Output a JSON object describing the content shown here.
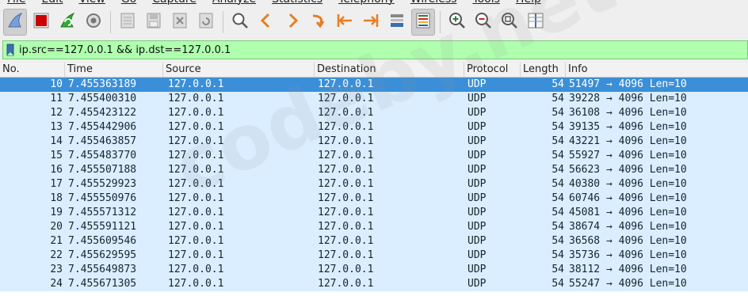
{
  "menu": [
    "File",
    "Edit",
    "View",
    "Go",
    "Capture",
    "Analyze",
    "Statistics",
    "Telephony",
    "Wireless",
    "Tools",
    "Help"
  ],
  "toolbar": [
    {
      "icon": "shark-fin-icon",
      "active": true
    },
    {
      "icon": "stop-icon",
      "active": false
    },
    {
      "icon": "restart-capture-icon",
      "active": false
    },
    {
      "icon": "capture-options-icon",
      "active": false
    },
    {
      "sep": true
    },
    {
      "icon": "open-file-icon",
      "active": false
    },
    {
      "icon": "save-file-icon",
      "active": false
    },
    {
      "icon": "close-file-icon",
      "active": false
    },
    {
      "icon": "reload-icon",
      "active": false
    },
    {
      "sep": true
    },
    {
      "icon": "find-packet-icon",
      "active": false
    },
    {
      "icon": "go-back-icon",
      "active": false
    },
    {
      "icon": "go-forward-icon",
      "active": false
    },
    {
      "icon": "go-to-packet-icon",
      "active": false
    },
    {
      "icon": "first-packet-icon",
      "active": false
    },
    {
      "icon": "last-packet-icon",
      "active": false
    },
    {
      "icon": "auto-scroll-icon",
      "active": false
    },
    {
      "icon": "colorize-icon",
      "active": true
    },
    {
      "sep": true
    },
    {
      "icon": "zoom-in-icon",
      "active": false
    },
    {
      "icon": "zoom-out-icon",
      "active": false
    },
    {
      "icon": "normal-size-icon",
      "active": false
    },
    {
      "icon": "resize-columns-icon",
      "active": false
    }
  ],
  "filter": {
    "value": "ip.src==127.0.0.1 && ip.dst==127.0.0.1"
  },
  "colors": {
    "filter_ok": "#afffaf",
    "selected_row": "#3a8fd8",
    "udp_row": "#daeeff"
  },
  "columns": {
    "no": "No.",
    "time": "Time",
    "source": "Source",
    "destination": "Destination",
    "protocol": "Protocol",
    "length": "Length",
    "info": "Info"
  },
  "packets": [
    {
      "no": "10",
      "time": "7.455363189",
      "src": "127.0.0.1",
      "dst": "127.0.0.1",
      "proto": "UDP",
      "len": "54",
      "info": "51497 → 4096 Len=10",
      "selected": true
    },
    {
      "no": "11",
      "time": "7.455400310",
      "src": "127.0.0.1",
      "dst": "127.0.0.1",
      "proto": "UDP",
      "len": "54",
      "info": "39228 → 4096 Len=10"
    },
    {
      "no": "12",
      "time": "7.455423122",
      "src": "127.0.0.1",
      "dst": "127.0.0.1",
      "proto": "UDP",
      "len": "54",
      "info": "36108 → 4096 Len=10"
    },
    {
      "no": "13",
      "time": "7.455442906",
      "src": "127.0.0.1",
      "dst": "127.0.0.1",
      "proto": "UDP",
      "len": "54",
      "info": "39135 → 4096 Len=10"
    },
    {
      "no": "14",
      "time": "7.455463857",
      "src": "127.0.0.1",
      "dst": "127.0.0.1",
      "proto": "UDP",
      "len": "54",
      "info": "43221 → 4096 Len=10"
    },
    {
      "no": "15",
      "time": "7.455483770",
      "src": "127.0.0.1",
      "dst": "127.0.0.1",
      "proto": "UDP",
      "len": "54",
      "info": "55927 → 4096 Len=10"
    },
    {
      "no": "16",
      "time": "7.455507188",
      "src": "127.0.0.1",
      "dst": "127.0.0.1",
      "proto": "UDP",
      "len": "54",
      "info": "56623 → 4096 Len=10"
    },
    {
      "no": "17",
      "time": "7.455529923",
      "src": "127.0.0.1",
      "dst": "127.0.0.1",
      "proto": "UDP",
      "len": "54",
      "info": "40380 → 4096 Len=10"
    },
    {
      "no": "18",
      "time": "7.455550976",
      "src": "127.0.0.1",
      "dst": "127.0.0.1",
      "proto": "UDP",
      "len": "54",
      "info": "60746 → 4096 Len=10"
    },
    {
      "no": "19",
      "time": "7.455571312",
      "src": "127.0.0.1",
      "dst": "127.0.0.1",
      "proto": "UDP",
      "len": "54",
      "info": "45081 → 4096 Len=10"
    },
    {
      "no": "20",
      "time": "7.455591121",
      "src": "127.0.0.1",
      "dst": "127.0.0.1",
      "proto": "UDP",
      "len": "54",
      "info": "38674 → 4096 Len=10"
    },
    {
      "no": "21",
      "time": "7.455609546",
      "src": "127.0.0.1",
      "dst": "127.0.0.1",
      "proto": "UDP",
      "len": "54",
      "info": "36568 → 4096 Len=10"
    },
    {
      "no": "22",
      "time": "7.455629595",
      "src": "127.0.0.1",
      "dst": "127.0.0.1",
      "proto": "UDP",
      "len": "54",
      "info": "35736 → 4096 Len=10"
    },
    {
      "no": "23",
      "time": "7.455649873",
      "src": "127.0.0.1",
      "dst": "127.0.0.1",
      "proto": "UDP",
      "len": "54",
      "info": "38112 → 4096 Len=10"
    },
    {
      "no": "24",
      "time": "7.455671305",
      "src": "127.0.0.1",
      "dst": "127.0.0.1",
      "proto": "UDP",
      "len": "54",
      "info": "55247 → 4096 Len=10"
    }
  ]
}
